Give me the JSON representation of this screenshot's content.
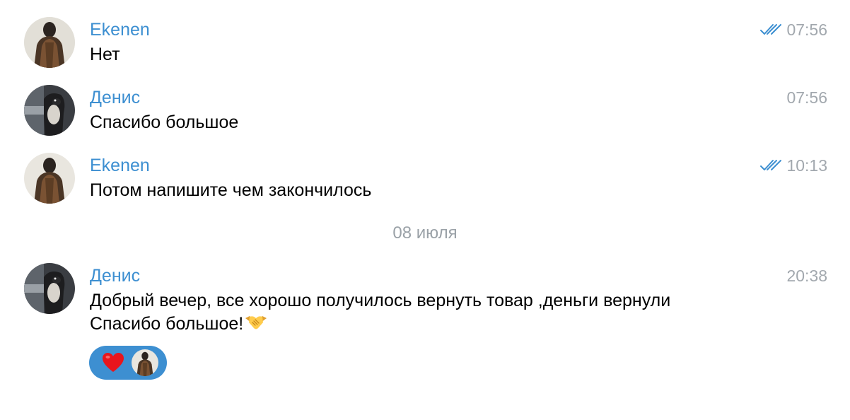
{
  "messages": [
    {
      "sender": "Ekenen",
      "text": "Нет",
      "time": "07:56",
      "read_status": "read-double-check",
      "avatar_icon": "person-back-photo"
    },
    {
      "sender": "Денис",
      "text": "Спасибо большое",
      "time": "07:56",
      "avatar_icon": "dog-photo"
    },
    {
      "sender": "Ekenen",
      "text": "Потом напишите чем закончилось",
      "time": "10:13",
      "read_status": "read-double-check",
      "avatar_icon": "person-back-photo"
    },
    {
      "sender": "Денис",
      "text_line1": "Добрый вечер, все хорошо получилось вернуть товар ,деньги вернули",
      "text_line2": "Спасибо большое!",
      "emoji": "handshake",
      "time": "20:38",
      "avatar_icon": "dog-photo",
      "reaction": {
        "emoji": "red-heart",
        "reactor_avatar": "person-back-photo"
      }
    }
  ],
  "date_separator": "08 июля",
  "colors": {
    "accent": "#3d8fd1",
    "time": "#a2a8ae",
    "text": "#000000",
    "background": "#ffffff"
  }
}
